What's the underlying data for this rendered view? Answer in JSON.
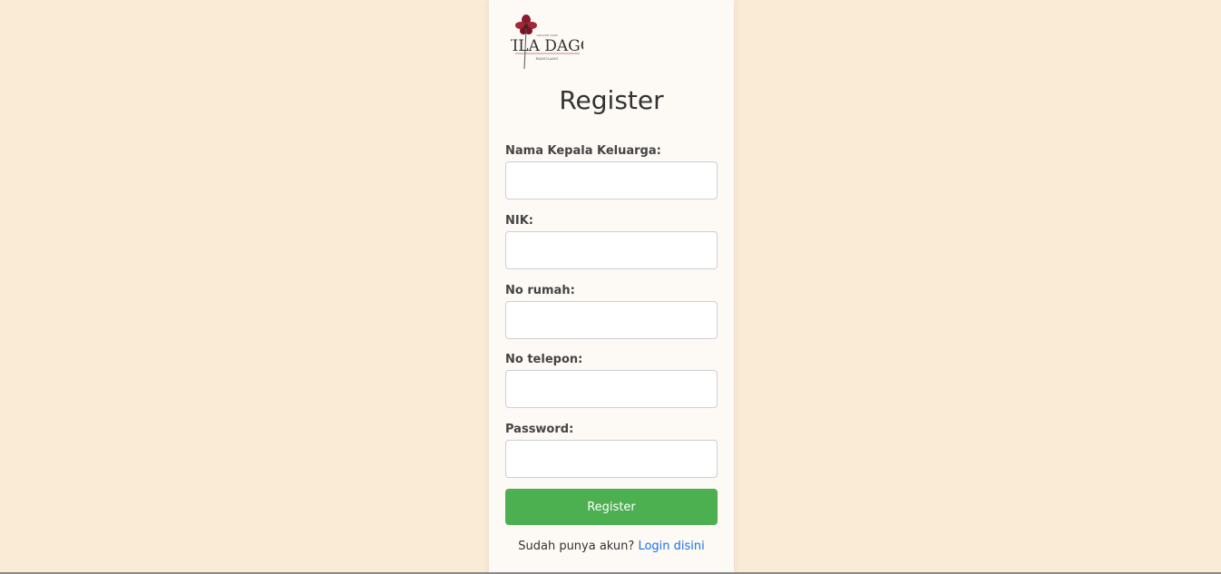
{
  "logo": {
    "name": "VILA DAGO",
    "top_text": "GOLDEN STAR",
    "sub_text": "PAMULANG"
  },
  "title": "Register",
  "fields": [
    {
      "label": "Nama Kepala Keluarga:",
      "value": "",
      "placeholder": ""
    },
    {
      "label": "NIK:",
      "value": "",
      "placeholder": ""
    },
    {
      "label": "No rumah:",
      "value": "",
      "placeholder": ""
    },
    {
      "label": "No telepon:",
      "value": "",
      "placeholder": ""
    },
    {
      "label": "Password:",
      "value": "",
      "placeholder": ""
    }
  ],
  "submit_label": "Register",
  "footer": {
    "prompt": "Sudah punya akun?",
    "link_label": "Login disini"
  },
  "colors": {
    "background": "#faebd7",
    "card": "#fdf9f5",
    "button": "#4caf50",
    "link": "#1a73e8"
  }
}
